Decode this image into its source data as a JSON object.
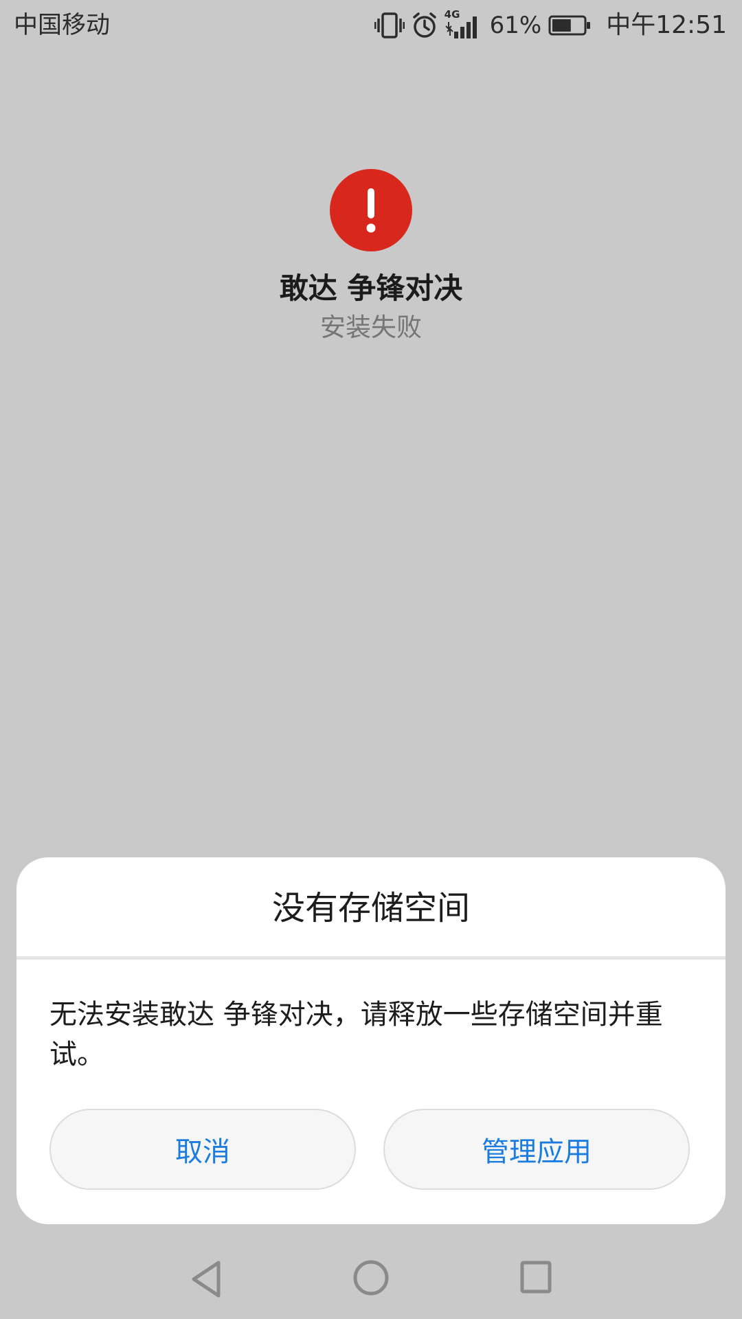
{
  "status_bar": {
    "carrier": "中国移动",
    "network_label": "4G",
    "battery_percent": "61%",
    "battery_level": 0.61,
    "time": "中午12:51",
    "icons": [
      "vibrate-icon",
      "alarm-icon",
      "signal-4g-icon",
      "battery-icon"
    ]
  },
  "install": {
    "app_name": "敢达 争锋对决",
    "status": "安装失败",
    "error_icon": "exclamation-circle-icon",
    "error_color": "#d8281d"
  },
  "dialog": {
    "title": "没有存储空间",
    "message": "无法安装敢达 争锋对决，请释放一些存储空间并重试。",
    "cancel_label": "取消",
    "manage_label": "管理应用",
    "button_text_color": "#1a7be0"
  },
  "nav_bar": {
    "icons": [
      "back-icon",
      "home-icon",
      "recent-apps-icon"
    ]
  }
}
